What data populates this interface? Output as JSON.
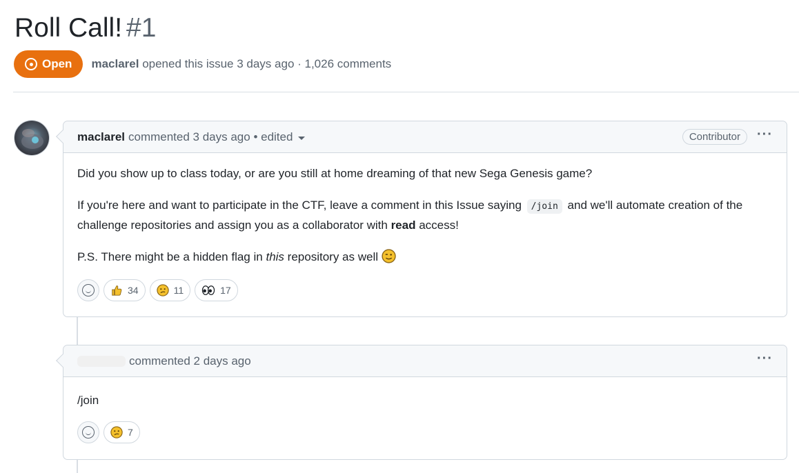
{
  "issue": {
    "title": "Roll Call!",
    "number": "#1",
    "state": "Open",
    "author": "maclarel",
    "opened_text": "opened this issue 3 days ago · 1,026 comments"
  },
  "colors": {
    "open_badge": "#e8700f",
    "border": "#d0d7de",
    "header_bg": "#f6f8fa",
    "muted": "#59636e"
  },
  "comments": [
    {
      "author": "maclarel",
      "action": "commented 3 days ago • edited",
      "role": "Contributor",
      "menu_icon": "kebab-horizontal-icon",
      "body": {
        "p1": "Did you show up to class today, or are you still at home dreaming of that new Sega Genesis game?",
        "p2_before": "If you're here and want to participate in the CTF, leave a comment in this Issue saying",
        "p2_code": "/join",
        "p2_mid": "and we'll automate creation of the challenge repositories and assign you as a collaborator with",
        "p2_bold": "read",
        "p2_after": "access!",
        "p3_before": "P.S. There might be a hidden flag in",
        "p3_em": "this",
        "p3_after": "repository as well"
      },
      "reactions": [
        {
          "icon": "thumbs-up-icon",
          "count": "34"
        },
        {
          "icon": "confused-face-icon",
          "count": "11"
        },
        {
          "icon": "eyes-icon",
          "count": "17"
        }
      ]
    },
    {
      "author": "",
      "action": "commented 2 days ago",
      "menu_icon": "kebab-horizontal-icon",
      "body": {
        "p1": "/join"
      },
      "reactions": [
        {
          "icon": "confused-face-icon",
          "count": "7"
        }
      ]
    }
  ]
}
